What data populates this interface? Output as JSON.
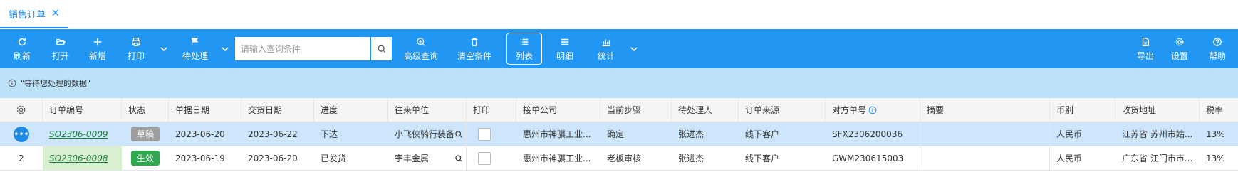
{
  "tab": {
    "title": "销售订单"
  },
  "toolbar": {
    "refresh": "刷新",
    "open": "打开",
    "new": "新增",
    "print": "打印",
    "pending": "待处理",
    "search_placeholder": "请输入查询条件",
    "advanced": "高级查询",
    "clear": "清空条件",
    "list": "列表",
    "detail": "明细",
    "stats": "统计",
    "export": "导出",
    "settings": "设置",
    "help": "帮助"
  },
  "info": {
    "text": "\"等待您处理的数据\""
  },
  "columns": {
    "order_no": "订单编号",
    "status": "状态",
    "doc_date": "单据日期",
    "delivery_date": "交货日期",
    "progress": "进度",
    "partner": "往来单位",
    "print": "打印",
    "company": "接单公司",
    "step": "当前步骤",
    "handler": "待处理人",
    "source": "订单来源",
    "counter_no": "对方单号",
    "summary": "摘要",
    "currency": "币别",
    "address": "收货地址",
    "tax": "税率"
  },
  "rows": [
    {
      "idx": "",
      "order_no": "SO2306-0009",
      "status": "草稿",
      "doc_date": "2023-06-20",
      "delivery_date": "2023-06-22",
      "progress": "下达",
      "partner": "小飞侠骑行装备",
      "company": "惠州市神骐工业...",
      "step": "确定",
      "handler": "张进杰",
      "source": "线下客户",
      "counter_no": "SFX2306200036",
      "summary": "",
      "currency": "人民币",
      "address": "江苏省 苏州市姑...",
      "tax": "13%"
    },
    {
      "idx": "2",
      "order_no": "SO2306-0008",
      "status": "生效",
      "doc_date": "2023-06-19",
      "delivery_date": "2023-06-20",
      "progress": "已发货",
      "partner": "宇丰金属",
      "company": "惠州市神骐工业...",
      "step": "老板审核",
      "handler": "张进杰",
      "source": "线下客户",
      "counter_no": "GWM230615003",
      "summary": "",
      "currency": "人民币",
      "address": "广东省 江门市市...",
      "tax": "13%"
    }
  ]
}
